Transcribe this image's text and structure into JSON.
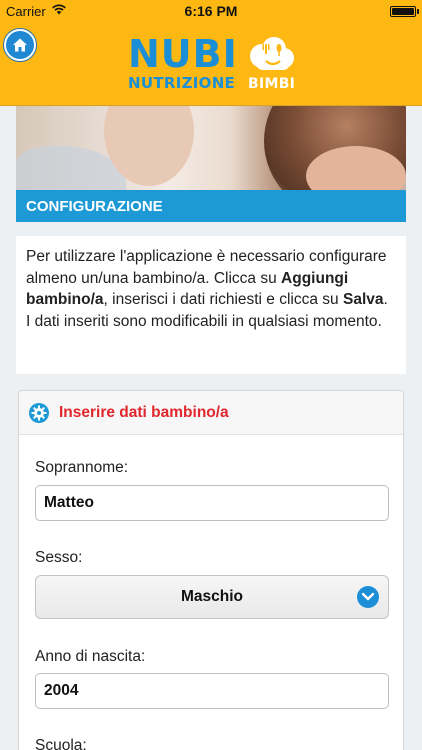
{
  "status_bar": {
    "carrier": "Carrier",
    "time": "6:16 PM"
  },
  "header": {
    "logo_main": "NUBI",
    "logo_sub1": "NUTRIZIONE",
    "logo_sub2": "BIMBI",
    "home_icon": "home-icon",
    "accent": "#fdb813",
    "brand_blue": "#1a8fd6"
  },
  "section": {
    "title": "CONFIGURAZIONE",
    "color": "#1d9ad6"
  },
  "intro": {
    "p1": "Per utilizzare l'applicazione è necessario configurare almeno un/una bambino/a. Clicca su ",
    "add_bold": "Aggiungi bambino/a",
    "p2": ", inserisci i dati richiesti e clicca su ",
    "save_bold": "Salva",
    "p3": ".",
    "p4": "I dati inseriti sono modificabili in qualsiasi momento."
  },
  "form": {
    "title": "Inserire dati bambino/a",
    "title_color": "#e1262d",
    "nickname_label": "Soprannome:",
    "nickname_value": "Matteo",
    "sex_label": "Sesso:",
    "sex_value": "Maschio",
    "birth_label": "Anno di nascita:",
    "birth_value": "2004",
    "school_label": "Scuola:"
  }
}
